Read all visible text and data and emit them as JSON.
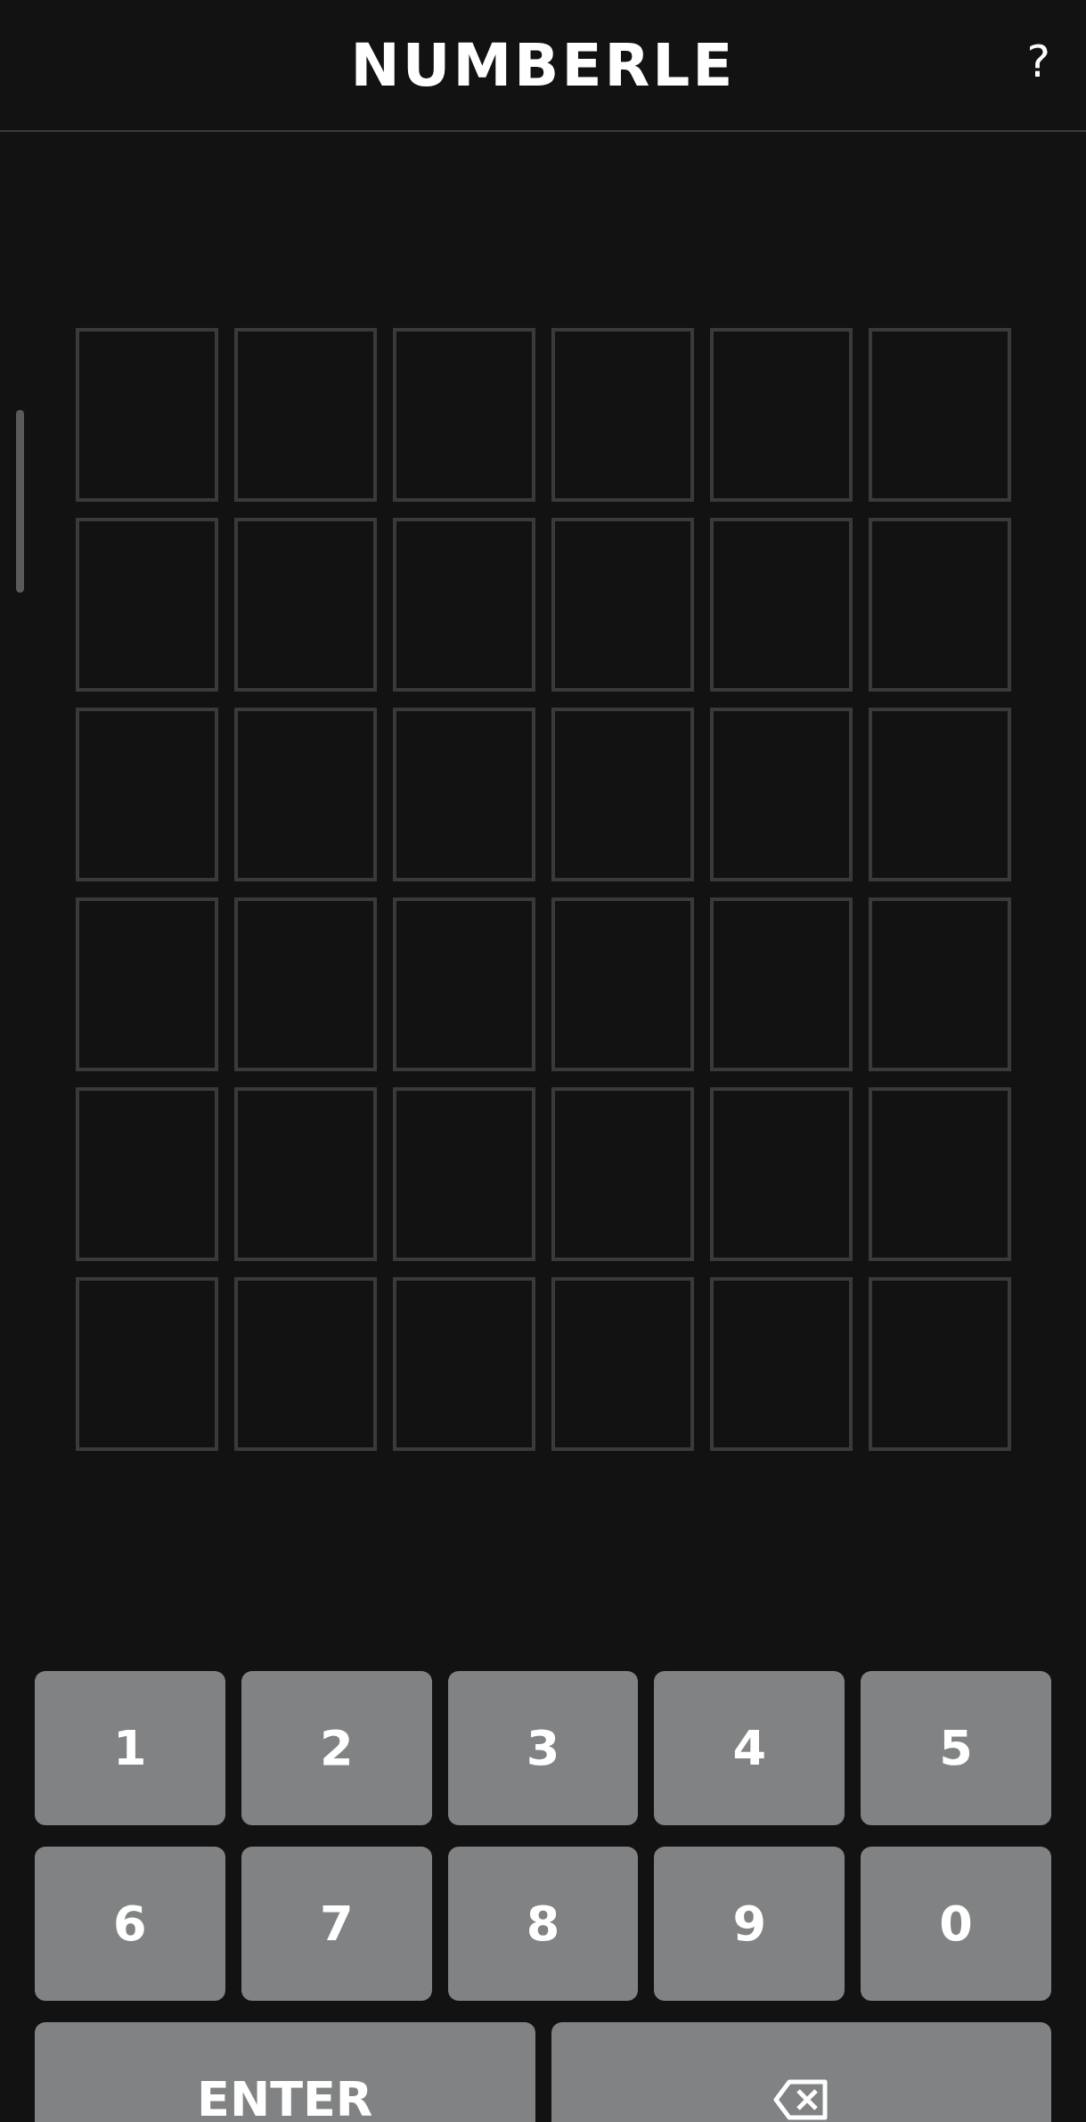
{
  "header": {
    "title": "NUMBERLE",
    "help": "?"
  },
  "board": {
    "rows": [
      {
        "cells": [
          {
            "kind": "empty"
          },
          {
            "kind": "empty"
          },
          {
            "kind": "empty"
          },
          {
            "kind": "empty"
          },
          {
            "kind": "empty"
          },
          {
            "kind": "empty"
          }
        ]
      },
      {
        "cells": [
          {
            "kind": "empty"
          },
          {
            "kind": "empty"
          },
          {
            "kind": "empty"
          },
          {
            "kind": "empty"
          },
          {
            "kind": "empty"
          },
          {
            "kind": "empty"
          }
        ]
      },
      {
        "cells": [
          {
            "kind": "empty"
          },
          {
            "kind": "empty"
          },
          {
            "kind": "empty"
          },
          {
            "kind": "empty"
          },
          {
            "kind": "empty"
          },
          {
            "kind": "empty"
          }
        ]
      },
      {
        "cells": [
          {
            "kind": "empty"
          },
          {
            "kind": "empty"
          },
          {
            "kind": "empty"
          },
          {
            "kind": "empty"
          },
          {
            "kind": "empty"
          },
          {
            "kind": "empty"
          }
        ]
      },
      {
        "cells": [
          {
            "kind": "empty"
          },
          {
            "kind": "empty"
          },
          {
            "kind": "empty"
          },
          {
            "kind": "empty"
          },
          {
            "kind": "empty"
          },
          {
            "kind": "empty"
          }
        ]
      },
      {
        "cells": [
          {
            "kind": "empty"
          },
          {
            "kind": "empty"
          },
          {
            "kind": "empty"
          },
          {
            "kind": "empty"
          },
          {
            "kind": "empty"
          },
          {
            "kind": "empty"
          }
        ]
      }
    ]
  },
  "keyboard": {
    "rows": [
      {
        "keys": [
          {
            "kind": "char",
            "label": "1"
          },
          {
            "kind": "char",
            "label": "2"
          },
          {
            "kind": "char",
            "label": "3"
          },
          {
            "kind": "char",
            "label": "4"
          },
          {
            "kind": "char",
            "label": "5"
          }
        ]
      },
      {
        "keys": [
          {
            "kind": "char",
            "label": "6"
          },
          {
            "kind": "char",
            "label": "7"
          },
          {
            "kind": "char",
            "label": "8"
          },
          {
            "kind": "char",
            "label": "9"
          },
          {
            "kind": "char",
            "label": "0"
          }
        ]
      },
      {
        "keys": [
          {
            "kind": "enter",
            "label": "ENTER"
          },
          {
            "kind": "backspace"
          }
        ]
      }
    ]
  }
}
